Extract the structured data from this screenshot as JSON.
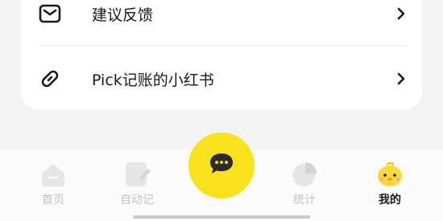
{
  "settings": {
    "items": [
      {
        "label": "建议反馈",
        "icon": "mail-icon"
      },
      {
        "label": "Pick记账的小红书",
        "icon": "link-icon"
      }
    ]
  },
  "tabbar": {
    "tabs": [
      {
        "label": "首页",
        "icon": "home-icon",
        "active": false
      },
      {
        "label": "自动记",
        "icon": "auto-record-icon",
        "active": false
      },
      {
        "label": "统计",
        "icon": "pie-chart-icon",
        "active": false
      },
      {
        "label": "我的",
        "icon": "chick-avatar-icon",
        "active": true
      }
    ],
    "center_button": {
      "icon": "chat-bubble-icon"
    }
  },
  "colors": {
    "accent": "#f7e21c",
    "inactive": "#c2c2c2",
    "text": "#1a1a1a"
  }
}
